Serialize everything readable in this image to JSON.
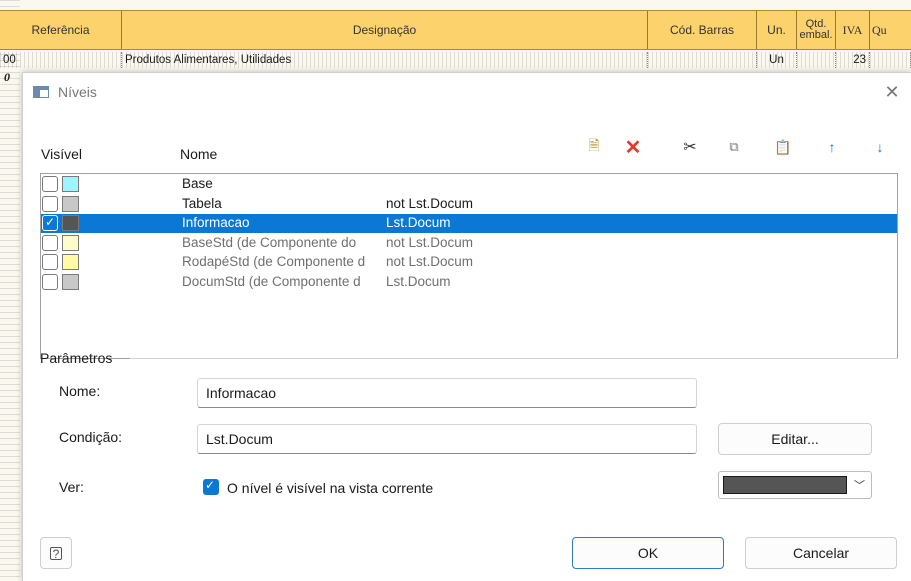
{
  "background": {
    "columns": [
      "Referência",
      "Designação",
      "Cód. Barras",
      "Un.",
      "Qtd. embal.",
      "IVA",
      "Qu"
    ],
    "row": {
      "ref": "00",
      "designacao": "Produtos Alimentares, Utilidades",
      "un": "Un",
      "iva": "23"
    },
    "row2_char": "0"
  },
  "dialog": {
    "title": "Níveis",
    "title_icon": "window-icon",
    "list_header": {
      "visivel": "Visível",
      "nome": "Nome"
    },
    "toolbar": [
      {
        "name": "new-level-icon",
        "glyph": "🗎"
      },
      {
        "name": "delete-icon",
        "glyph": "✕"
      },
      {
        "name": "cut-icon",
        "glyph": "✂"
      },
      {
        "name": "copy-icon",
        "glyph": "⧉"
      },
      {
        "name": "paste-icon",
        "glyph": "📋"
      },
      {
        "name": "move-up-icon",
        "glyph": "↑"
      },
      {
        "name": "move-down-icon",
        "glyph": "↓"
      }
    ],
    "levels": [
      {
        "name": "Base",
        "condition": "",
        "color": "#9ff5ff",
        "checked": false,
        "dim": false
      },
      {
        "name": "Tabela",
        "condition": "not Lst.Docum",
        "color": "#c8c8c8",
        "checked": false,
        "dim": false
      },
      {
        "name": "Informacao",
        "condition": "Lst.Docum",
        "color": "#555555",
        "checked": true,
        "dim": false,
        "selected": true
      },
      {
        "name": "BaseStd (de Componente do",
        "condition": "not Lst.Docum",
        "color": "#fffccc",
        "checked": false,
        "dim": true
      },
      {
        "name": "RodapéStd (de Componente d",
        "condition": "not Lst.Docum",
        "color": "#fff9a8",
        "checked": false,
        "dim": true
      },
      {
        "name": "DocumStd (de Componente d",
        "condition": "Lst.Docum",
        "color": "#c8c8c8",
        "checked": false,
        "dim": true
      }
    ],
    "params": {
      "section": "Parâmetros",
      "nome_label": "Nome:",
      "nome_value": "Informacao",
      "condicao_label": "Condição:",
      "condicao_value": "Lst.Docum",
      "editar_label": "Editar...",
      "ver_label": "Ver:",
      "visible_checkbox": "O nível é visível na vista corrente",
      "color_value": "#555555"
    },
    "footer": {
      "ok": "OK",
      "cancel": "Cancelar"
    }
  }
}
